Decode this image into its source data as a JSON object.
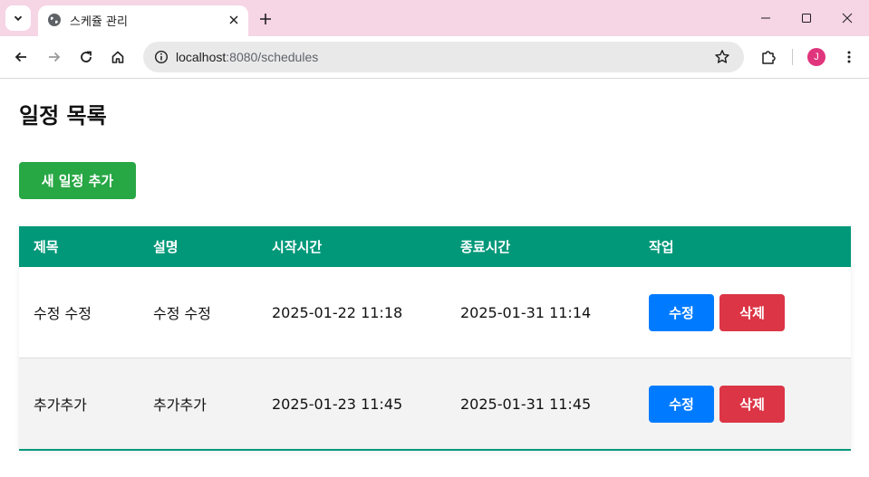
{
  "browser": {
    "tab_title": "스케쥴 관리",
    "url_host": "localhost",
    "url_rest": ":8080/schedules",
    "avatar_letter": "J",
    "accent_color": "#f6d5e5"
  },
  "page": {
    "title": "일정 목록",
    "add_button_label": "새 일정 추가"
  },
  "table": {
    "headers": [
      "제목",
      "설명",
      "시작시간",
      "종료시간",
      "작업"
    ],
    "rows": [
      {
        "title": "수정 수정",
        "description": "수정 수정",
        "start": "2025-01-22 11:18",
        "end": "2025-01-31 11:14",
        "edit_label": "수정",
        "delete_label": "삭제"
      },
      {
        "title": "추가추가",
        "description": "추가추가",
        "start": "2025-01-23 11:45",
        "end": "2025-01-31 11:45",
        "edit_label": "수정",
        "delete_label": "삭제"
      }
    ],
    "header_color": "#009879",
    "edit_color": "#007bff",
    "delete_color": "#dc3545",
    "add_color": "#28a745"
  },
  "icons": {
    "tab_search": "chevron-down-icon",
    "favicon": "globe-icon",
    "tab_close": "close-icon",
    "new_tab": "plus-icon",
    "back": "arrow-left-icon",
    "forward": "arrow-right-icon",
    "reload": "reload-icon",
    "home": "home-icon",
    "site_info": "info-icon",
    "bookmark": "star-icon",
    "extensions": "puzzle-icon",
    "menu": "more-vertical-icon"
  }
}
